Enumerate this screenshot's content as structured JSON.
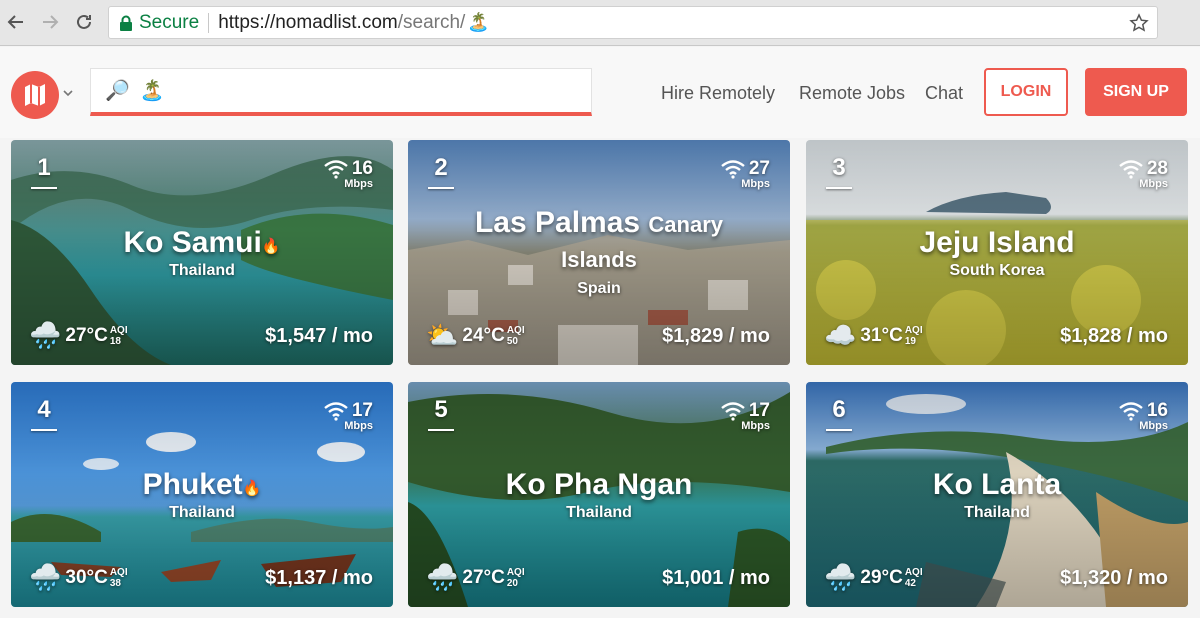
{
  "browser": {
    "secure_label": "Secure",
    "url_host": "https://nomadlist.com",
    "url_path": "/search/",
    "url_emoji": "🏝️"
  },
  "header": {
    "search_value": "🏝️",
    "search_icon": "🔎",
    "nav": [
      "Hire Remotely",
      "Remote Jobs",
      "Chat"
    ],
    "login_label": "LOGIN",
    "signup_label": "SIGN UP"
  },
  "colors": {
    "brand": "#ee5a4f",
    "secure": "#0b8043"
  },
  "cards": [
    {
      "rank": "1",
      "city": "Ko Samui",
      "city_suffix": "",
      "city_line2": "",
      "fire": true,
      "country": "Thailand",
      "wifi": "16",
      "wifi_unit": "Mbps",
      "weather_icon": "🌧️",
      "temp": "27°C",
      "aqi_label": "AQI",
      "aqi": "18",
      "cost": "$1,547 / mo"
    },
    {
      "rank": "2",
      "city": "Las Palmas",
      "city_suffix": "Canary",
      "city_line2": "Islands",
      "fire": false,
      "country": "Spain",
      "wifi": "27",
      "wifi_unit": "Mbps",
      "weather_icon": "⛅",
      "temp": "24°C",
      "aqi_label": "AQI",
      "aqi": "50",
      "cost": "$1,829 / mo"
    },
    {
      "rank": "3",
      "city": "Jeju Island",
      "city_suffix": "",
      "city_line2": "",
      "fire": false,
      "country": "South Korea",
      "wifi": "28",
      "wifi_unit": "Mbps",
      "weather_icon": "☁️",
      "temp": "31°C",
      "aqi_label": "AQI",
      "aqi": "19",
      "cost": "$1,828 / mo"
    },
    {
      "rank": "4",
      "city": "Phuket",
      "city_suffix": "",
      "city_line2": "",
      "fire": true,
      "country": "Thailand",
      "wifi": "17",
      "wifi_unit": "Mbps",
      "weather_icon": "🌧️",
      "temp": "30°C",
      "aqi_label": "AQI",
      "aqi": "38",
      "cost": "$1,137 / mo"
    },
    {
      "rank": "5",
      "city": "Ko Pha Ngan",
      "city_suffix": "",
      "city_line2": "",
      "fire": false,
      "country": "Thailand",
      "wifi": "17",
      "wifi_unit": "Mbps",
      "weather_icon": "🌧️",
      "temp": "27°C",
      "aqi_label": "AQI",
      "aqi": "20",
      "cost": "$1,001 / mo"
    },
    {
      "rank": "6",
      "city": "Ko Lanta",
      "city_suffix": "",
      "city_line2": "",
      "fire": false,
      "country": "Thailand",
      "wifi": "16",
      "wifi_unit": "Mbps",
      "weather_icon": "🌧️",
      "temp": "29°C",
      "aqi_label": "AQI",
      "aqi": "42",
      "cost": "$1,320 / mo"
    }
  ]
}
